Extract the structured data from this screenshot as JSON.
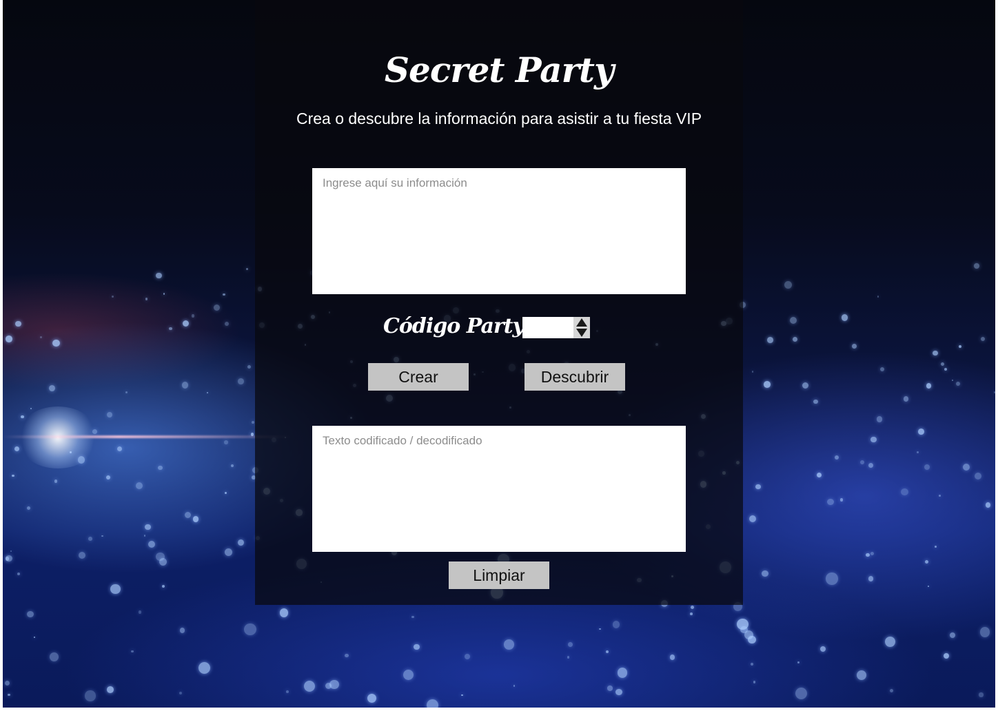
{
  "header": {
    "title": "Secret Party",
    "subtitle": "Crea o descubre la información para asistir a tu fiesta VIP"
  },
  "form": {
    "info_placeholder": "Ingrese aquí su información",
    "info_value": "",
    "code_label": "Código Party :",
    "code_value": "",
    "create_label": "Crear",
    "discover_label": "Descubrir",
    "output_placeholder": "Texto codificado / decodificado",
    "output_value": "",
    "clear_label": "Limpiar"
  },
  "colors": {
    "button_bg": "#c4c4c4",
    "panel_bg": "rgba(8,8,14,0.72)",
    "text": "#ffffff"
  }
}
